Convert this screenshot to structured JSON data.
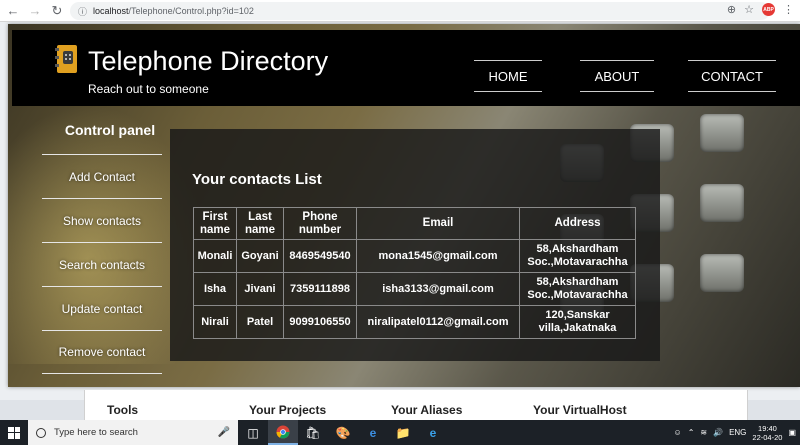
{
  "browser": {
    "url_host": "localhost",
    "url_path": "/Telephone/Control.php?id=102",
    "extension_badge": "ABP"
  },
  "header": {
    "title": "Telephone Directory",
    "tagline": "Reach out to someone",
    "nav": [
      "HOME",
      "ABOUT",
      "CONTACT"
    ]
  },
  "sidebar": {
    "title": "Control panel",
    "items": [
      "Add Contact",
      "Show contacts",
      "Search contacts",
      "Update contact",
      "Remove contact"
    ]
  },
  "contacts": {
    "heading": "Your contacts List",
    "columns": [
      "First name",
      "Last name",
      "Phone number",
      "Email",
      "Address"
    ],
    "rows": [
      [
        "Monali",
        "Goyani",
        "8469549540",
        "mona1545@gmail.com",
        "58,Akshardham Soc.,Motavarachha"
      ],
      [
        "Isha",
        "Jivani",
        "7359111898",
        "isha3133@gmail.com",
        "58,Akshardham Soc.,Motavarachha"
      ],
      [
        "Nirali",
        "Patel",
        "9099106550",
        "niralipatel0112@gmail.com",
        "120,Sanskar villa,Jakatnaka"
      ]
    ]
  },
  "lower_section": {
    "headings": [
      "Tools",
      "Your Projects",
      "Your Aliases",
      "Your VirtualHost"
    ]
  },
  "taskbar": {
    "search_placeholder": "Type here to search",
    "language": "ENG",
    "time": "19:40",
    "date": "22-04-20"
  },
  "colors": {
    "header_bg": "#000000",
    "panel_bg": "rgba(25,25,25,0.82)",
    "text": "#ffffff"
  }
}
